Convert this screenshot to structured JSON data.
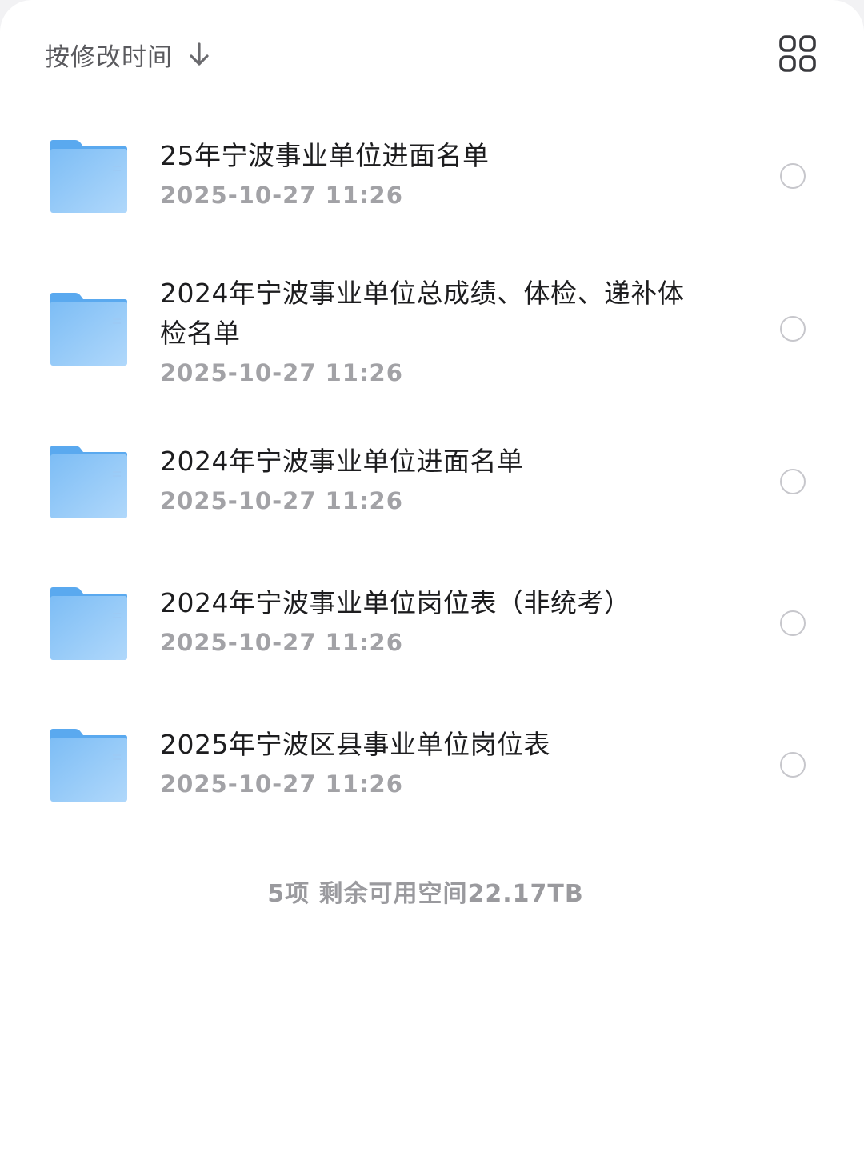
{
  "toolbar": {
    "sort_label": "按修改时间",
    "sort_icon": "arrow-down-icon",
    "view_icon": "grid-view-icon"
  },
  "colors": {
    "folder_tab": "#5aa9ef",
    "folder_front_top": "#7dbdf5",
    "folder_front_bottom": "#a9d4fa",
    "title_text": "#1d1d1f",
    "date_text": "#a2a2a6",
    "circle_border": "#c7c7cc"
  },
  "items": [
    {
      "title": "25年宁波事业单位进面名单",
      "date": "2025-10-27 11:26",
      "icon": "folder-icon"
    },
    {
      "title": "2024年宁波事业单位总成绩、体检、递补体检名单",
      "date": "2025-10-27 11:26",
      "icon": "folder-icon"
    },
    {
      "title": "2024年宁波事业单位进面名单",
      "date": "2025-10-27 11:26",
      "icon": "folder-icon"
    },
    {
      "title": "2024年宁波事业单位岗位表（非统考）",
      "date": "2025-10-27 11:26",
      "icon": "folder-icon"
    },
    {
      "title": "2025年宁波区县事业单位岗位表",
      "date": "2025-10-27 11:26",
      "icon": "folder-icon"
    }
  ],
  "footer": {
    "summary": "5项 剩余可用空间22.17TB"
  }
}
